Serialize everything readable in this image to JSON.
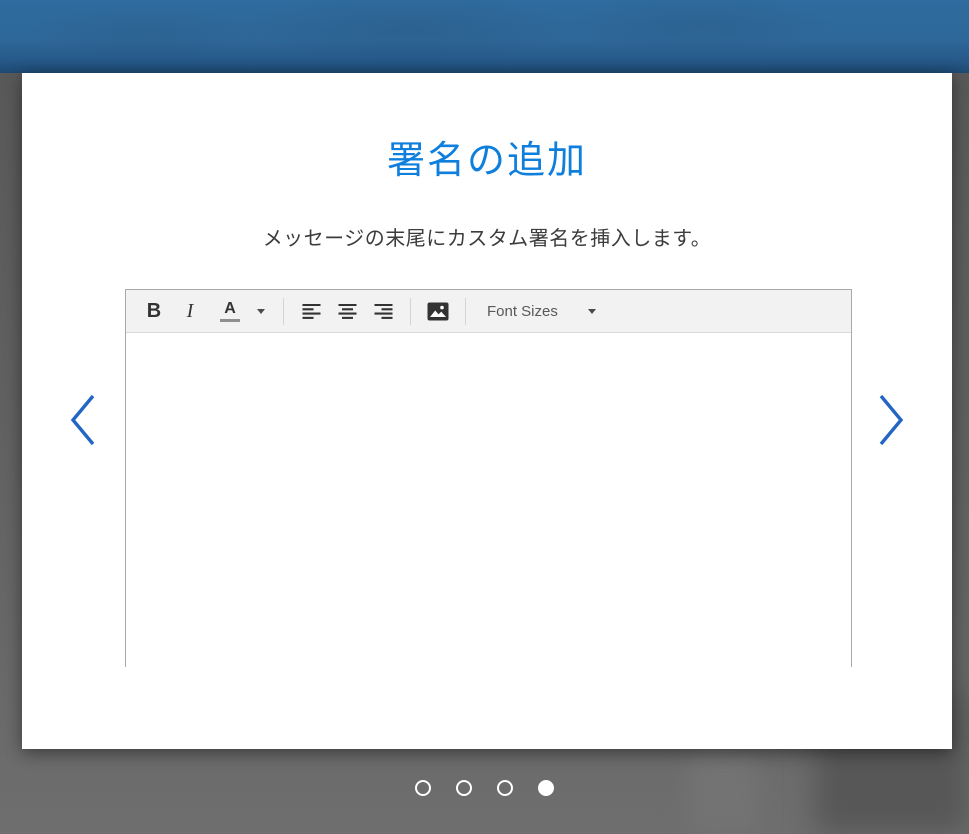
{
  "colors": {
    "header_blue": "#2f6b9e",
    "title_blue": "#0e7fdc",
    "chevron_blue": "#2365c4",
    "toolbar_bg": "#f2f2f2"
  },
  "dialog": {
    "title": "署名の追加",
    "subtitle": "メッセージの末尾にカスタム署名を挿入します。"
  },
  "editor": {
    "toolbar": {
      "bold": "B",
      "italic": "I",
      "text_color": "A",
      "align_left_icon": "align-left",
      "align_center_icon": "align-center",
      "align_right_icon": "align-right",
      "image_icon": "image",
      "font_sizes": "Font Sizes"
    },
    "content": ""
  },
  "carousel": {
    "prev_icon": "chevron-left",
    "next_icon": "chevron-right",
    "active_index": 3,
    "dots": [
      {
        "active": false
      },
      {
        "active": false
      },
      {
        "active": false
      },
      {
        "active": true
      }
    ]
  }
}
